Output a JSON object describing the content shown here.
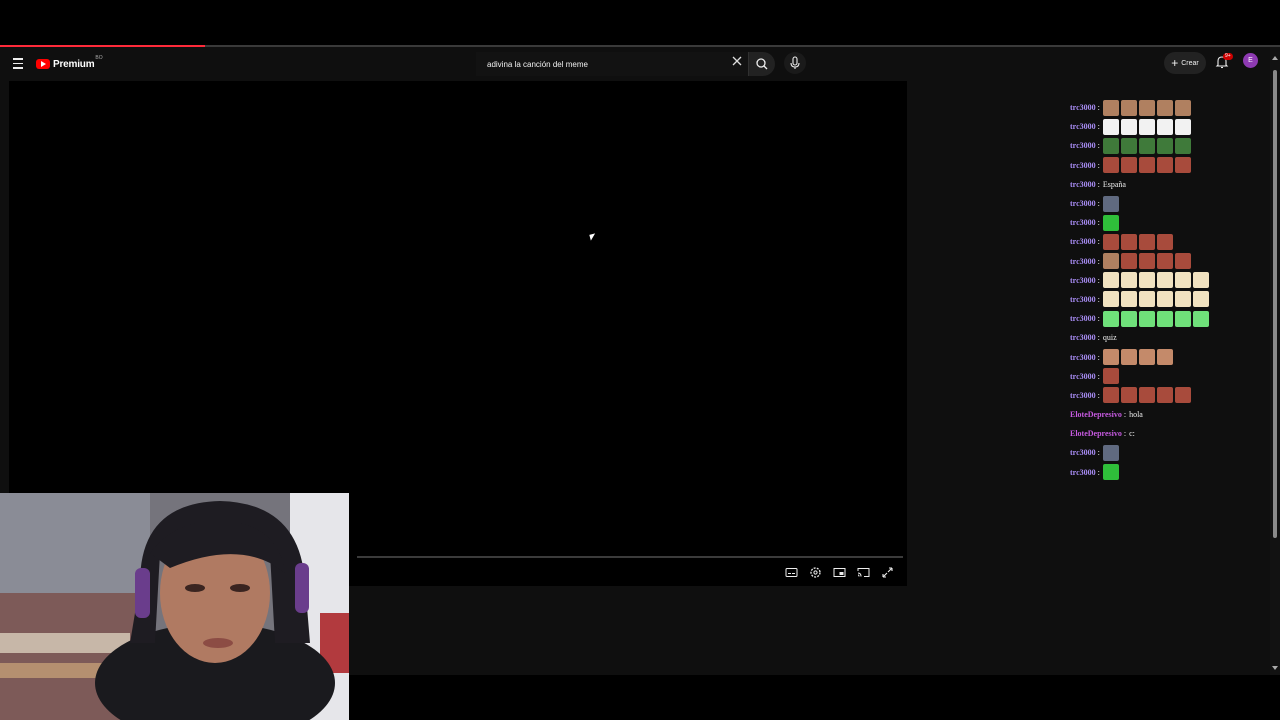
{
  "app": {
    "brand": "Premium",
    "country_code": "BO",
    "load_progress": 0.16
  },
  "search": {
    "query": "adivina la canción del meme"
  },
  "header": {
    "create_label": "Crear",
    "notification_badge": "9+",
    "avatar_letter": "E"
  },
  "colors": {
    "accent_red": "#ff0000",
    "avatar": "#8e3ab2",
    "user_trc": "#a98df5",
    "user_elote": "#c65ae0"
  },
  "player": {
    "controls": [
      "subtitles-icon",
      "settings-icon",
      "miniplayer-icon",
      "cast-icon",
      "fullscreen-icon"
    ]
  },
  "chat": {
    "messages": [
      {
        "user": "trc3000",
        "color": "#a98df5",
        "text": "",
        "emotes": [
          "#b08060",
          "#b08060",
          "#b08060",
          "#b08060",
          "#b08060"
        ]
      },
      {
        "user": "trc3000",
        "color": "#a98df5",
        "text": "",
        "emotes": [
          "#f2f2f2",
          "#f2f2f2",
          "#f2f2f2",
          "#f2f2f2",
          "#f2f2f2"
        ]
      },
      {
        "user": "trc3000",
        "color": "#a98df5",
        "text": "",
        "emotes": [
          "#3f7a3a",
          "#3f7a3a",
          "#3f7a3a",
          "#3f7a3a",
          "#3f7a3a"
        ]
      },
      {
        "user": "trc3000",
        "color": "#a98df5",
        "text": "",
        "emotes": [
          "#a84b3c",
          "#a84b3c",
          "#a84b3c",
          "#a84b3c",
          "#a84b3c"
        ]
      },
      {
        "user": "trc3000",
        "color": "#a98df5",
        "text": "España",
        "emotes": []
      },
      {
        "user": "trc3000",
        "color": "#a98df5",
        "text": "",
        "emotes": [
          "#606a80"
        ]
      },
      {
        "user": "trc3000",
        "color": "#a98df5",
        "text": "",
        "emotes": [
          "#2fbf3a"
        ]
      },
      {
        "user": "trc3000",
        "color": "#a98df5",
        "text": "",
        "emotes": [
          "#a84b3c",
          "#a84b3c",
          "#a84b3c",
          "#a84b3c"
        ]
      },
      {
        "user": "trc3000",
        "color": "#a98df5",
        "text": "",
        "emotes": [
          "#b08060",
          "#a84b3c",
          "#a84b3c",
          "#a84b3c",
          "#a84b3c"
        ]
      },
      {
        "user": "trc3000",
        "color": "#a98df5",
        "text": "",
        "emotes": [
          "#f1e2c0",
          "#f1e2c0",
          "#f1e2c0",
          "#f1e2c0",
          "#f1e2c0",
          "#f1e2c0"
        ]
      },
      {
        "user": "trc3000",
        "color": "#a98df5",
        "text": "",
        "emotes": [
          "#f1e2c0",
          "#f1e2c0",
          "#f1e2c0",
          "#f1e2c0",
          "#f1e2c0",
          "#f1e2c0"
        ]
      },
      {
        "user": "trc3000",
        "color": "#a98df5",
        "text": "",
        "emotes": [
          "#6fe07a",
          "#6fe07a",
          "#6fe07a",
          "#6fe07a",
          "#6fe07a",
          "#6fe07a"
        ]
      },
      {
        "user": "trc3000",
        "color": "#a98df5",
        "text": "quiz",
        "emotes": []
      },
      {
        "user": "trc3000",
        "color": "#a98df5",
        "text": "",
        "emotes": [
          "#c48a6a",
          "#c48a6a",
          "#c48a6a",
          "#c48a6a"
        ]
      },
      {
        "user": "trc3000",
        "color": "#a98df5",
        "text": "",
        "emotes": [
          "#a84b3c"
        ]
      },
      {
        "user": "trc3000",
        "color": "#a98df5",
        "text": "",
        "emotes": [
          "#a84b3c",
          "#a84b3c",
          "#a84b3c",
          "#a84b3c",
          "#a84b3c"
        ]
      },
      {
        "user": "EloteDepresivo",
        "color": "#c65ae0",
        "text": "hola",
        "emotes": []
      },
      {
        "user": "EloteDepresivo",
        "color": "#c65ae0",
        "text": "c:",
        "emotes": []
      },
      {
        "user": "trc3000",
        "color": "#a98df5",
        "text": "",
        "emotes": [
          "#606a80"
        ]
      },
      {
        "user": "trc3000",
        "color": "#a98df5",
        "text": "",
        "emotes": [
          "#2fbf3a"
        ]
      }
    ]
  }
}
